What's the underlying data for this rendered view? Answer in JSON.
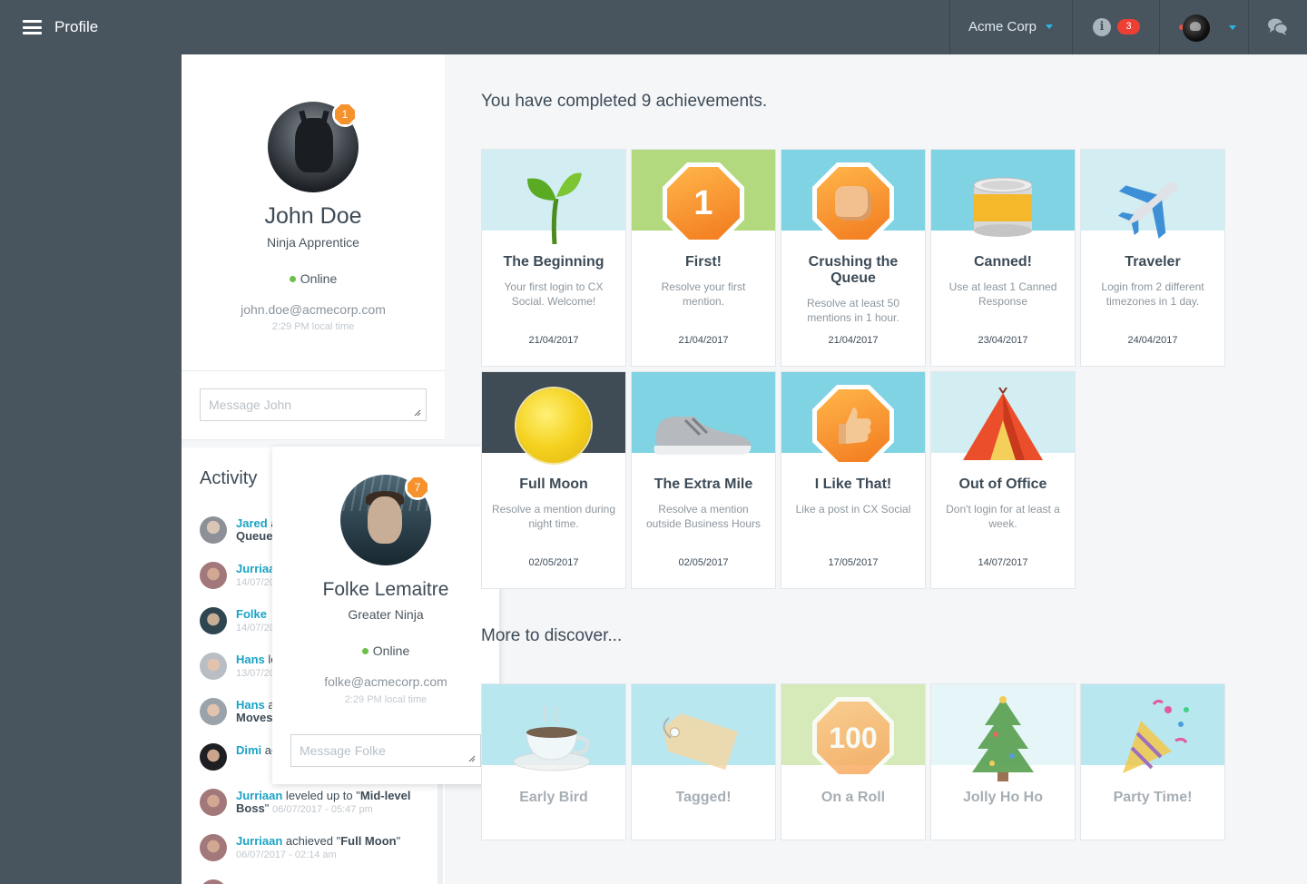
{
  "topbar": {
    "title": "Profile",
    "org": "Acme Corp",
    "notifications": "3",
    "colors": {
      "bar": "#48555f",
      "accent": "#2ab8e4",
      "badge": "#ee3f35"
    }
  },
  "profile": {
    "name": "John Doe",
    "role": "Ninja Apprentice",
    "level_badge": "1",
    "status": "Online",
    "email": "john.doe@acmecorp.com",
    "local_time": "2:29 PM local time",
    "message_placeholder": "Message John"
  },
  "activity": {
    "title": "Activity",
    "items": [
      {
        "who": "Jared",
        "text": " a",
        "bold": "Queue",
        "when": ""
      },
      {
        "who": "Jurriaa",
        "text": "",
        "bold": "",
        "when": "14/07/20"
      },
      {
        "who": "Folke",
        "text": "",
        "bold": "",
        "when": "14/07/20"
      },
      {
        "who": "Hans",
        "text": " le",
        "bold": "",
        "when": "13/07/20"
      },
      {
        "who": "Hans",
        "text": " a",
        "bold": "Moves",
        "when": ""
      },
      {
        "who": "Dimi",
        "text": " ac",
        "bold": "",
        "when": ""
      },
      {
        "who": "Jurriaan",
        "text": " leveled up to \"",
        "bold": "Mid-level Boss",
        "after": "\"",
        "when": "06/07/2017 - 05:47 pm"
      },
      {
        "who": "Jurriaan",
        "text": " achieved \"",
        "bold": "Full Moon",
        "after": "\"",
        "when": "06/07/2017 - 02:14 am"
      }
    ]
  },
  "popup": {
    "name": "Folke Lemaitre",
    "role": "Greater Ninja",
    "level_badge": "7",
    "status": "Online",
    "email": "folke@acmecorp.com",
    "local_time": "2:29 PM local time",
    "message_placeholder": "Message Folke"
  },
  "achievements": {
    "heading": "You have completed 9 achievements.",
    "completed": [
      {
        "title": "The Beginning",
        "desc": "Your first login to CX Social. Welcome!",
        "date": "21/04/2017",
        "icon": "sprout-icon",
        "band": "#d2eef2"
      },
      {
        "title": "First!",
        "desc": "Resolve your first mention.",
        "date": "21/04/2017",
        "icon": "number-one-hex-icon",
        "icon_text": "1",
        "band": "#b3d97e"
      },
      {
        "title": "Crushing the Queue",
        "desc": "Resolve at least 50 mentions in 1 hour.",
        "date": "21/04/2017",
        "icon": "fist-hex-icon",
        "band": "#7fd3e2"
      },
      {
        "title": "Canned!",
        "desc": "Use at least 1 Canned Response",
        "date": "23/04/2017",
        "icon": "tin-can-icon",
        "band": "#7fd3e2"
      },
      {
        "title": "Traveler",
        "desc": "Login from 2 different timezones in 1 day.",
        "date": "24/04/2017",
        "icon": "airplane-icon",
        "band": "#d2eef2"
      },
      {
        "title": "Full Moon",
        "desc": "Resolve a mention during night time.",
        "date": "02/05/2017",
        "icon": "moon-icon",
        "band": "#3f4b55"
      },
      {
        "title": "The Extra Mile",
        "desc": "Resolve a mention outside Business Hours",
        "date": "02/05/2017",
        "icon": "sneaker-icon",
        "band": "#7fd3e2"
      },
      {
        "title": "I Like That!",
        "desc": "Like a post in CX Social",
        "date": "17/05/2017",
        "icon": "thumbs-up-hex-icon",
        "band": "#7fd3e2"
      },
      {
        "title": "Out of Office",
        "desc": "Don't login for at least a week.",
        "date": "14/07/2017",
        "icon": "tent-icon",
        "band": "#d2eef2"
      }
    ],
    "discover_heading": "More to discover...",
    "locked": [
      {
        "title": "Early Bird",
        "icon": "coffee-cup-icon",
        "band": "#7fd3e2"
      },
      {
        "title": "Tagged!",
        "icon": "tag-icon",
        "band": "#7fd3e2"
      },
      {
        "title": "On a Roll",
        "icon": "hundred-hex-icon",
        "icon_text": "100",
        "band": "#b3d97e"
      },
      {
        "title": "Jolly Ho Ho",
        "icon": "christmas-tree-icon",
        "band": "#d2eef2"
      },
      {
        "title": "Party Time!",
        "icon": "party-popper-icon",
        "band": "#7fd3e2"
      }
    ]
  }
}
